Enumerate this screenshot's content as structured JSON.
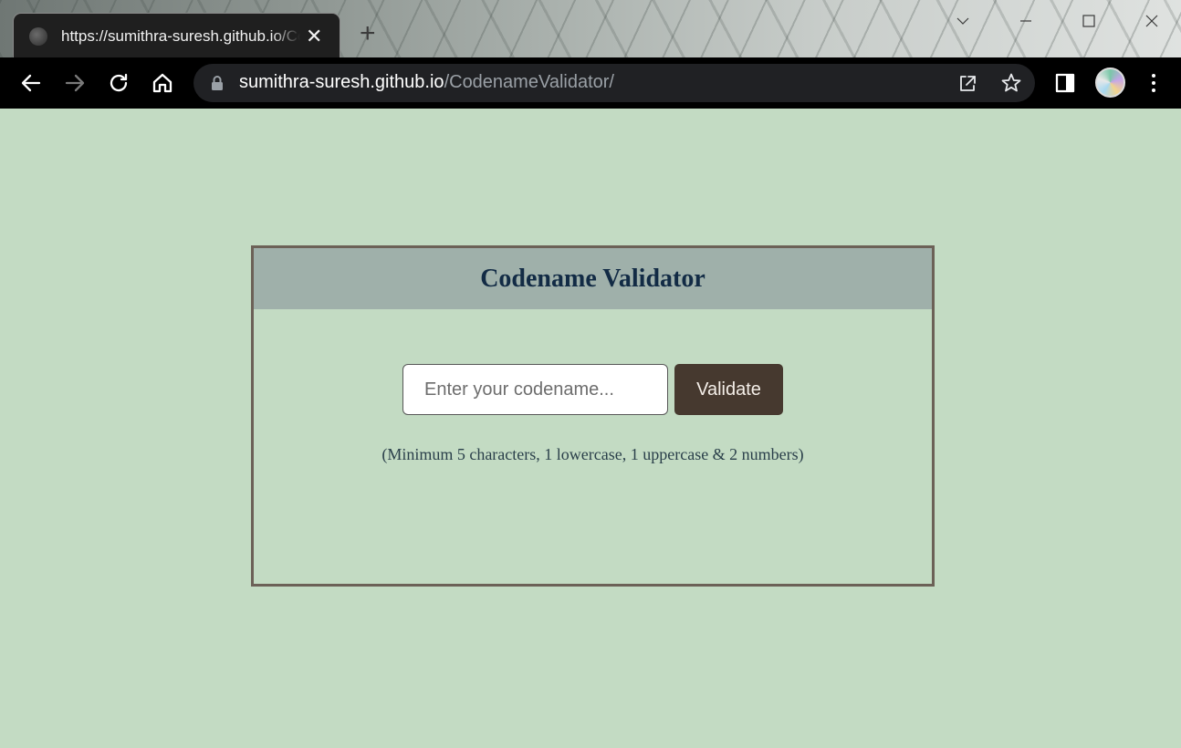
{
  "browser": {
    "tab_title": "https://sumithra-suresh.github.io/CodenameValidator/",
    "tab_close": "✕",
    "new_tab": "+",
    "url_host": "sumithra-suresh.github.io",
    "url_path": "/CodenameValidator/"
  },
  "page": {
    "title": "Codename Validator",
    "input_placeholder": "Enter your codename...",
    "input_value": "",
    "button_label": "Validate",
    "hint": "(Minimum 5 characters, 1 lowercase, 1 uppercase & 2 numbers)"
  },
  "colors": {
    "page_background": "#c3dbc3",
    "header_background": "#9fb0aa",
    "title_text": "#122b45",
    "button_background": "#46392f",
    "card_border": "#6c6157"
  },
  "icons": [
    "back-icon",
    "forward-icon",
    "reload-icon",
    "home-icon",
    "lock-icon",
    "share-icon",
    "star-icon",
    "side-panel-icon",
    "menu-icon"
  ]
}
